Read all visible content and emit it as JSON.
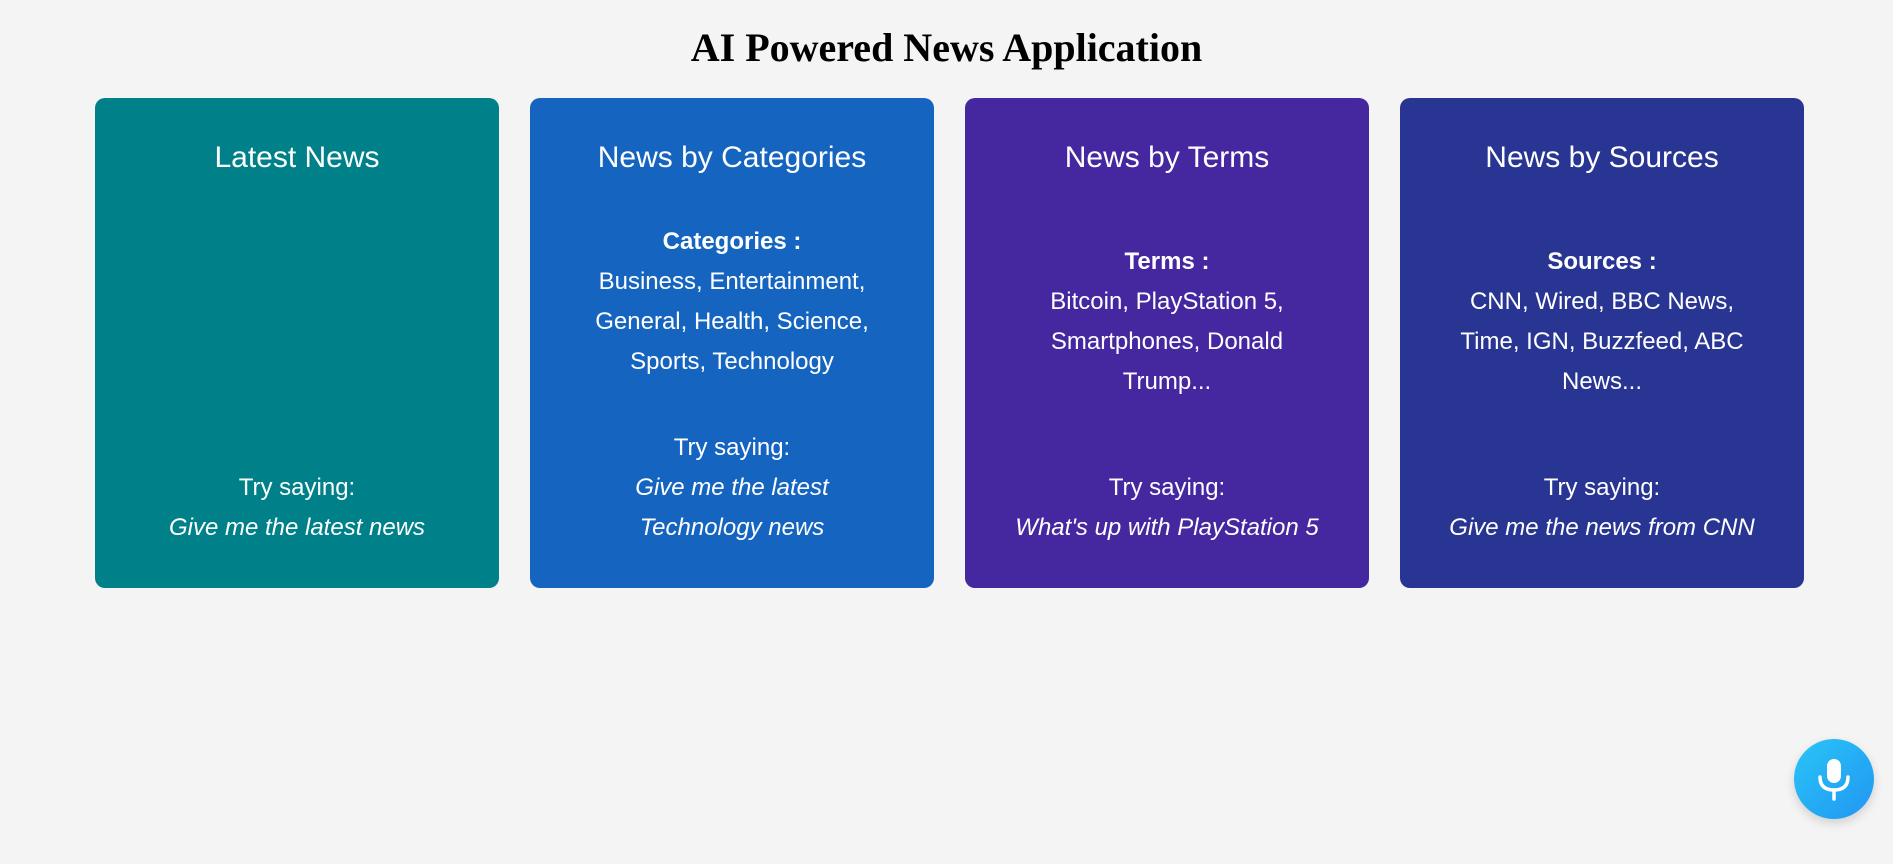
{
  "header": {
    "title": "AI Powered News Application"
  },
  "cards": [
    {
      "title": "Latest News",
      "color": "#008089",
      "try_label": "Try saying:",
      "try_example": "Give me the latest news"
    },
    {
      "title": "News by Categories",
      "color": "#1565c0",
      "info_label": "Categories :",
      "info_text": "Business, Entertainment, General, Health, Science, Sports, Technology",
      "try_label": "Try saying:",
      "try_example": "Give me the latest Technology news"
    },
    {
      "title": "News by Terms",
      "color": "#4527a0",
      "info_label": "Terms :",
      "info_text": "Bitcoin, PlayStation 5, Smartphones, Donald Trump...",
      "try_label": "Try saying:",
      "try_example": "What's up with PlayStation 5"
    },
    {
      "title": "News by Sources",
      "color": "#283593",
      "info_label": "Sources :",
      "info_text": "CNN, Wired, BBC News, Time, IGN, Buzzfeed, ABC News...",
      "try_label": "Try saying:",
      "try_example": "Give me the news from CNN"
    }
  ],
  "voice_button": {
    "icon": "microphone-icon",
    "color": "#29b6f6"
  }
}
